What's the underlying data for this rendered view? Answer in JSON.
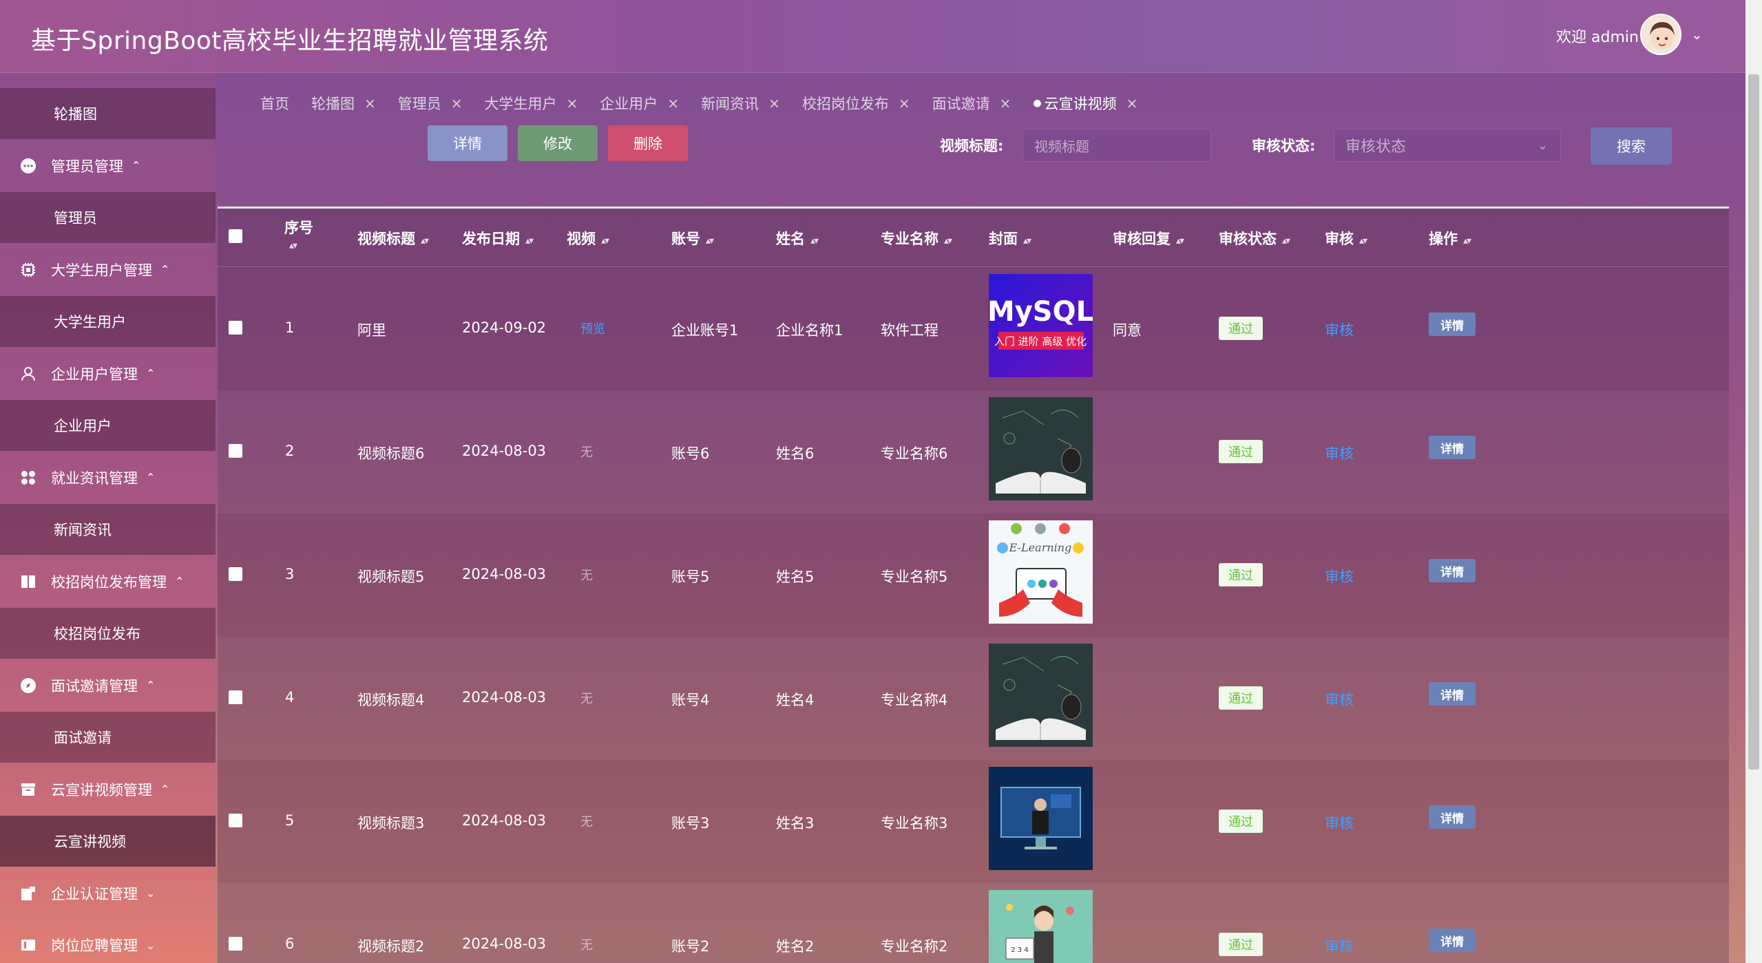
{
  "header": {
    "app_title": "基于SpringBoot高校毕业生招聘就业管理系统",
    "welcome": "欢迎 admin"
  },
  "sidebar": {
    "items": [
      {
        "label": "轮播图",
        "type": "child",
        "icon": ""
      },
      {
        "label": "管理员管理",
        "type": "parent",
        "icon": "chat-bubble-icon"
      },
      {
        "label": "管理员",
        "type": "child",
        "icon": ""
      },
      {
        "label": "大学生用户管理",
        "type": "parent",
        "icon": "chip-icon"
      },
      {
        "label": "大学生用户",
        "type": "child",
        "icon": ""
      },
      {
        "label": "企业用户管理",
        "type": "parent",
        "icon": "user-icon"
      },
      {
        "label": "企业用户",
        "type": "child",
        "icon": ""
      },
      {
        "label": "就业资讯管理",
        "type": "parent",
        "icon": "grid-icon"
      },
      {
        "label": "新闻资讯",
        "type": "child",
        "icon": ""
      },
      {
        "label": "校招岗位发布管理",
        "type": "parent",
        "icon": "book-icon"
      },
      {
        "label": "校招岗位发布",
        "type": "child",
        "icon": ""
      },
      {
        "label": "面试邀请管理",
        "type": "parent",
        "icon": "compass-icon"
      },
      {
        "label": "面试邀请",
        "type": "child",
        "icon": ""
      },
      {
        "label": "云宣讲视频管理",
        "type": "parent",
        "icon": "box-icon"
      },
      {
        "label": "云宣讲视频",
        "type": "child",
        "icon": ""
      },
      {
        "label": "企业认证管理",
        "type": "parent",
        "icon": "badge-icon"
      },
      {
        "label": "岗位应聘管理",
        "type": "parent",
        "icon": "panel-icon"
      }
    ]
  },
  "tabs": [
    "首页",
    "轮播图",
    "管理员",
    "大学生用户",
    "企业用户",
    "新闻资讯",
    "校招岗位发布",
    "面试邀请",
    "云宣讲视频"
  ],
  "toolbar": {
    "detail": "详情",
    "edit": "修改",
    "delete": "删除",
    "title_label": "视频标题:",
    "title_placeholder": "视频标题",
    "status_label": "审核状态:",
    "status_placeholder": "审核状态",
    "search": "搜索"
  },
  "table": {
    "columns": [
      "序号",
      "视频标题",
      "发布日期",
      "视频",
      "账号",
      "姓名",
      "专业名称",
      "封面",
      "审核回复",
      "审核状态",
      "审核",
      "操作"
    ],
    "rows": [
      {
        "idx": "1",
        "title": "阿里",
        "date": "2024-09-02",
        "video": "预览",
        "account": "企业账号1",
        "name": "企业名称1",
        "major": "软件工程",
        "cover": "mysql",
        "reply": "同意",
        "status": "通过",
        "audit": "审核",
        "op": "详情"
      },
      {
        "idx": "2",
        "title": "视频标题6",
        "date": "2024-08-03",
        "video": "无",
        "account": "账号6",
        "name": "姓名6",
        "major": "专业名称6",
        "cover": "book",
        "reply": "",
        "status": "通过",
        "audit": "审核",
        "op": "详情"
      },
      {
        "idx": "3",
        "title": "视频标题5",
        "date": "2024-08-03",
        "video": "无",
        "account": "账号5",
        "name": "姓名5",
        "major": "专业名称5",
        "cover": "elearning",
        "reply": "",
        "status": "通过",
        "audit": "审核",
        "op": "详情"
      },
      {
        "idx": "4",
        "title": "视频标题4",
        "date": "2024-08-03",
        "video": "无",
        "account": "账号4",
        "name": "姓名4",
        "major": "专业名称4",
        "cover": "book",
        "reply": "",
        "status": "通过",
        "audit": "审核",
        "op": "详情"
      },
      {
        "idx": "5",
        "title": "视频标题3",
        "date": "2024-08-03",
        "video": "无",
        "account": "账号3",
        "name": "姓名3",
        "major": "专业名称3",
        "cover": "presenter",
        "reply": "",
        "status": "通过",
        "audit": "审核",
        "op": "详情"
      },
      {
        "idx": "6",
        "title": "视频标题2",
        "date": "2024-08-03",
        "video": "无",
        "account": "账号2",
        "name": "姓名2",
        "major": "专业名称2",
        "cover": "teacher",
        "reply": "",
        "status": "通过",
        "audit": "审核",
        "op": "详情"
      }
    ]
  },
  "colors": {
    "link": "#409eff",
    "tag_success": "#67c23a",
    "btn_detail": "#8a93c7",
    "btn_edit": "#6d9a73",
    "btn_delete": "#cf4e6d",
    "btn_search": "#7572b3"
  }
}
